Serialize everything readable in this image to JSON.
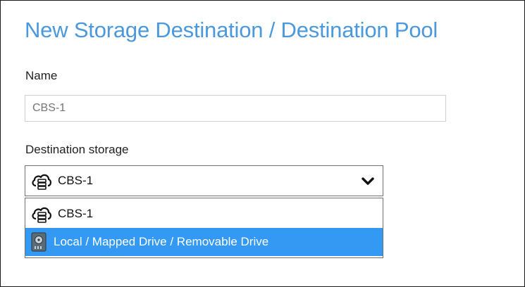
{
  "dialog": {
    "title": "New Storage Destination / Destination Pool"
  },
  "name_field": {
    "label": "Name",
    "placeholder": "CBS-1"
  },
  "destination": {
    "label": "Destination storage",
    "selected": "CBS-1",
    "options": [
      {
        "label": "CBS-1",
        "icon": "cloud-server-icon"
      },
      {
        "label": "Local / Mapped Drive / Removable Drive",
        "icon": "local-drive-icon"
      }
    ]
  },
  "colors": {
    "title": "#4a98dd",
    "highlight": "#3399f2"
  }
}
